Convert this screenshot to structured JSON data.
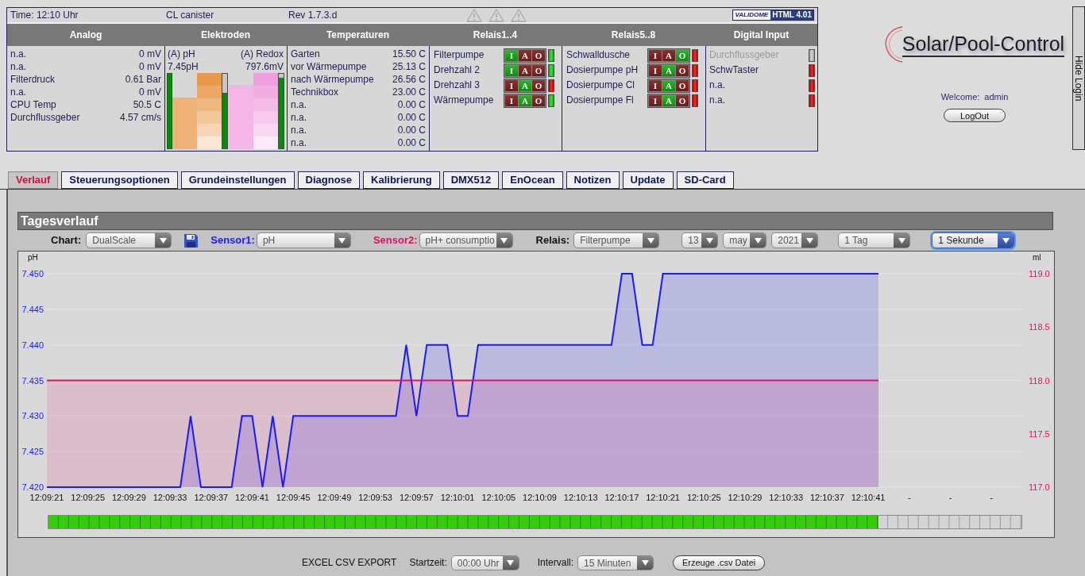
{
  "status_row": {
    "time": "Time: 12:10 Uhr",
    "device": "CL canister",
    "revision": "Rev 1.7.3.d",
    "alarms": [
      {
        "active": false
      },
      {
        "active": false
      },
      {
        "active": false
      }
    ],
    "badge": {
      "brand": "VALIDOME",
      "label": "HTML 4.01"
    }
  },
  "panels": [
    {
      "kind": "readings",
      "title": "Analog",
      "rows": [
        {
          "name": "n.a.",
          "value": "0 mV"
        },
        {
          "name": "n.a.",
          "value": "0 mV"
        },
        {
          "name": "Filterdruck",
          "value": "0.61 Bar"
        },
        {
          "name": "n.a.",
          "value": "0 mV"
        },
        {
          "name": "CPU Temp",
          "value": "50.5 C"
        },
        {
          "name": "Durchflussgeber",
          "value": "4.57 cm/s"
        }
      ]
    },
    {
      "kind": "electrodes",
      "title": "Elektroden",
      "electrodes": [
        {
          "label": "(A) pH",
          "reading": "7.45pH",
          "color": "#e8984a",
          "side_indicator": true,
          "bar": {
            "level": 0.68
          },
          "meter": {
            "level": 0.75
          }
        },
        {
          "label": "(A) Redox",
          "reading": "797.6mV",
          "color": "#f09ede",
          "bar": {
            "level": 0.84
          },
          "meter": {
            "level": 0.95
          }
        }
      ]
    },
    {
      "kind": "readings",
      "title": "Temperaturen",
      "rows": [
        {
          "name": "Garten",
          "value": "15.50 C"
        },
        {
          "name": "vor Wärmepumpe",
          "value": "25.13 C"
        },
        {
          "name": "nach Wärmepumpe",
          "value": "26.56 C"
        },
        {
          "name": "Technikbox",
          "value": "23.00 C"
        },
        {
          "name": "n.a.",
          "value": "0.00 C"
        },
        {
          "name": "n.a.",
          "value": "0.00 C"
        },
        {
          "name": "n.a.",
          "value": "0.00 C"
        },
        {
          "name": "n.a.",
          "value": "0.00 C"
        }
      ]
    },
    {
      "kind": "relays",
      "title": "Relais1..4",
      "relays": [
        {
          "name": "Filterpumpe",
          "on": true,
          "modes": [
            {
              "label": "I",
              "selected": true
            },
            {
              "label": "A",
              "selected": false
            },
            {
              "label": "O",
              "selected": false
            }
          ]
        },
        {
          "name": "Drehzahl 2",
          "on": true,
          "modes": [
            {
              "label": "I",
              "selected": true
            },
            {
              "label": "A",
              "selected": false
            },
            {
              "label": "O",
              "selected": false
            }
          ]
        },
        {
          "name": "Drehzahl 3",
          "on": false,
          "modes": [
            {
              "label": "I",
              "selected": false
            },
            {
              "label": "A",
              "selected": true
            },
            {
              "label": "O",
              "selected": false
            }
          ]
        },
        {
          "name": "Wärmepumpe",
          "on": true,
          "modes": [
            {
              "label": "I",
              "selected": false
            },
            {
              "label": "A",
              "selected": true
            },
            {
              "label": "O",
              "selected": false
            }
          ]
        }
      ]
    },
    {
      "kind": "relays",
      "title": "Relais5..8",
      "relays": [
        {
          "name": "Schwalldusche",
          "on": false,
          "modes": [
            {
              "label": "I",
              "selected": false
            },
            {
              "label": "A",
              "selected": false
            },
            {
              "label": "O",
              "selected": true
            }
          ]
        },
        {
          "name": "Dosierpumpe pH",
          "on": false,
          "modes": [
            {
              "label": "I",
              "selected": false
            },
            {
              "label": "A",
              "selected": true
            },
            {
              "label": "O",
              "selected": false
            }
          ]
        },
        {
          "name": "Dosierpumpe Cl",
          "on": false,
          "modes": [
            {
              "label": "I",
              "selected": false
            },
            {
              "label": "A",
              "selected": true
            },
            {
              "label": "O",
              "selected": false
            }
          ]
        },
        {
          "name": "Dosierpumpe Fl",
          "on": false,
          "modes": [
            {
              "label": "I",
              "selected": false
            },
            {
              "label": "A",
              "selected": true
            },
            {
              "label": "O",
              "selected": false
            }
          ]
        }
      ]
    },
    {
      "kind": "inputs",
      "title": "Digital Input",
      "inputs": [
        {
          "name": "Durchflussgeber",
          "disabled": true,
          "on": false
        },
        {
          "name": "SchwTaster",
          "disabled": false,
          "on": false
        },
        {
          "name": "n.a.",
          "disabled": false,
          "on": false
        },
        {
          "name": "n.a.",
          "disabled": false,
          "on": false
        }
      ]
    }
  ],
  "logo": {
    "text": "Solar/Pool-Control"
  },
  "session": {
    "welcome": "Welcome:",
    "user": "admin",
    "logout": "LogOut"
  },
  "hide_login": "Hide Login",
  "tabs": [
    {
      "label": "Verlauf",
      "selected": true
    },
    {
      "label": "Steuerungsoptionen",
      "selected": false
    },
    {
      "label": "Grundeinstellungen",
      "selected": false
    },
    {
      "label": "Diagnose",
      "selected": false
    },
    {
      "label": "Kalibrierung",
      "selected": false
    },
    {
      "label": "DMX512",
      "selected": false
    },
    {
      "label": "EnOcean",
      "selected": false
    },
    {
      "label": "Notizen",
      "selected": false
    },
    {
      "label": "Update",
      "selected": false
    },
    {
      "label": "SD-Card",
      "selected": false
    }
  ],
  "section": {
    "title": "Tagesverlauf",
    "controls": [
      {
        "kind": "label",
        "text": "Chart:",
        "color": "#111111"
      },
      {
        "kind": "select",
        "value": "DualScale",
        "focused": false
      },
      {
        "kind": "save"
      },
      {
        "kind": "label",
        "text": "Sensor1:",
        "color": "#1a1aff"
      },
      {
        "kind": "select",
        "value": "pH",
        "focused": false
      },
      {
        "kind": "label",
        "text": "Sensor2:",
        "color": "#e0106a"
      },
      {
        "kind": "select",
        "value": "pH+ consumptio",
        "focused": false
      },
      {
        "kind": "label",
        "text": "Relais:",
        "color": "#111111"
      },
      {
        "kind": "select",
        "value": "Filterpumpe",
        "focused": false
      },
      {
        "kind": "select",
        "value": "13",
        "focused": false
      },
      {
        "kind": "select",
        "value": "may",
        "focused": false
      },
      {
        "kind": "select",
        "value": "2021",
        "focused": false
      },
      {
        "kind": "select",
        "value": "1 Tag",
        "focused": false
      },
      {
        "kind": "select",
        "value": "1 Sekunde",
        "focused": true
      }
    ],
    "chart": {
      "chart_data": {
        "type": "area",
        "ylabel": "pH",
        "y2label": "ml",
        "grid": true,
        "categories": [
          "12:09:21",
          null,
          null,
          null,
          "12:09:25",
          null,
          null,
          null,
          "12:09:29",
          null,
          null,
          null,
          "12:09:33",
          null,
          null,
          null,
          "12:09:37",
          null,
          null,
          null,
          "12:09:41",
          null,
          null,
          null,
          "12:09:45",
          null,
          null,
          null,
          "12:09:49",
          null,
          null,
          null,
          "12:09:53",
          null,
          null,
          null,
          "12:09:57",
          null,
          null,
          null,
          "12:10:01",
          null,
          null,
          null,
          "12:10:05",
          null,
          null,
          null,
          "12:10:09",
          null,
          null,
          null,
          "12:10:13",
          null,
          null,
          null,
          "12:10:17",
          null,
          null,
          null,
          "12:10:21",
          null,
          null,
          null,
          "12:10:25",
          null,
          null,
          null,
          "12:10:29",
          null,
          null,
          null,
          "12:10:33",
          null,
          null,
          null,
          "12:10:37",
          null,
          null,
          null,
          "12:10:41",
          null,
          null,
          null,
          "-",
          null,
          null,
          null,
          "-",
          null,
          null,
          null,
          "-",
          null,
          null
        ],
        "ylim": [
          7.42,
          7.45
        ],
        "yticks": [
          {
            "value": 7.45,
            "label": "7.450"
          },
          {
            "value": 7.445,
            "label": "7.445"
          },
          {
            "value": 7.44,
            "label": "7.440"
          },
          {
            "value": 7.435,
            "label": "7.435"
          },
          {
            "value": 7.43,
            "label": "7.430"
          },
          {
            "value": 7.425,
            "label": "7.425"
          },
          {
            "value": 7.42,
            "label": "7.420"
          }
        ],
        "y2lim": [
          117,
          119
        ],
        "y2ticks": [
          {
            "value": 119,
            "label": "119.0"
          },
          {
            "value": 118.5,
            "label": "118.5"
          },
          {
            "value": 118,
            "label": "118.0"
          },
          {
            "value": 117.5,
            "label": "117.5"
          },
          {
            "value": 117,
            "label": "117.0"
          }
        ],
        "series": [
          {
            "color": "#1a1aff",
            "values": [
              7.42,
              7.42,
              7.42,
              7.42,
              7.42,
              7.42,
              7.42,
              7.42,
              7.42,
              7.42,
              7.42,
              7.42,
              7.42,
              7.42,
              7.43,
              7.42,
              7.42,
              7.42,
              7.42,
              7.43,
              7.43,
              7.42,
              7.43,
              7.42,
              7.43,
              7.43,
              7.43,
              7.43,
              7.43,
              7.43,
              7.43,
              7.43,
              7.43,
              7.43,
              7.43,
              7.44,
              7.43,
              7.44,
              7.44,
              7.44,
              7.43,
              7.43,
              7.44,
              7.44,
              7.44,
              7.44,
              7.44,
              7.44,
              7.44,
              7.44,
              7.44,
              7.44,
              7.44,
              7.44,
              7.44,
              7.44,
              7.45,
              7.45,
              7.44,
              7.44,
              7.45,
              7.45,
              7.45,
              7.45,
              7.45,
              7.45,
              7.45,
              7.45,
              7.45,
              7.45,
              7.45,
              7.45,
              7.45,
              7.45,
              7.45,
              7.45,
              7.45,
              7.45,
              7.45,
              7.45,
              7.45,
              7.45,
              null,
              null,
              null,
              null,
              null,
              null,
              null,
              null,
              null,
              null,
              null,
              null,
              null
            ]
          },
          {
            "color": "#e0106a",
            "axis": "y2",
            "values": [
              118,
              118,
              118,
              118,
              118,
              118,
              118,
              118,
              118,
              118,
              118,
              118,
              118,
              118,
              118,
              118,
              118,
              118,
              118,
              118,
              118,
              118,
              118,
              118,
              118,
              118,
              118,
              118,
              118,
              118,
              118,
              118,
              118,
              118,
              118,
              118,
              118,
              118,
              118,
              118,
              118,
              118,
              118,
              118,
              118,
              118,
              118,
              118,
              118,
              118,
              118,
              118,
              118,
              118,
              118,
              118,
              118,
              118,
              118,
              118,
              118,
              118,
              118,
              118,
              118,
              118,
              118,
              118,
              118,
              118,
              118,
              118,
              118,
              118,
              118,
              118,
              118,
              118,
              118,
              118,
              118,
              118,
              null,
              null,
              null,
              null,
              null,
              null,
              null,
              null,
              null,
              null,
              null,
              null,
              null
            ]
          }
        ]
      },
      "progress": {
        "level": 0.853
      }
    },
    "export": {
      "title": "EXCEL CSV EXPORT",
      "start_label": "Startzeit:",
      "start_value": "00:00 Uhr",
      "interval_label": "Intervall:",
      "interval_value": "15 Minuten",
      "button": "Erzeuge .csv Datei"
    }
  }
}
